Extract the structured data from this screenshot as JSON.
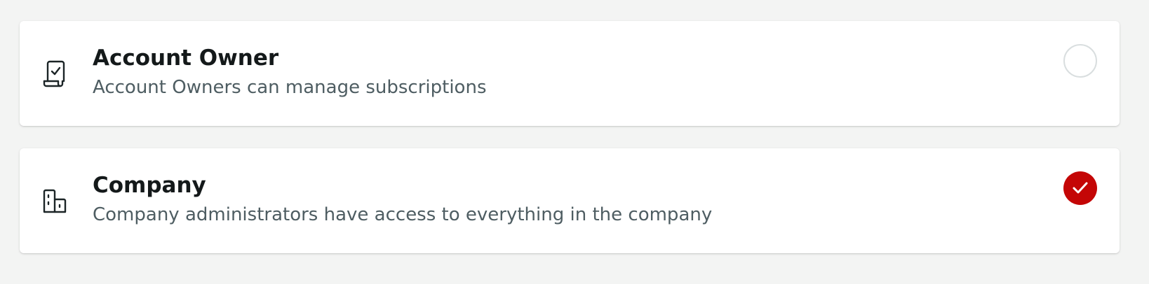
{
  "options": [
    {
      "title": "Account Owner",
      "description": "Account Owners can manage subscriptions",
      "icon": "receipt-check-icon",
      "selected": false
    },
    {
      "title": "Company",
      "description": "Company administrators have access to everything in the company",
      "icon": "buildings-icon",
      "selected": true
    }
  ],
  "colors": {
    "background": "#f3f4f3",
    "card": "#ffffff",
    "title": "#14191a",
    "description": "#4e5d62",
    "selected_accent": "#c40606",
    "radio_border": "#d9dedf"
  }
}
